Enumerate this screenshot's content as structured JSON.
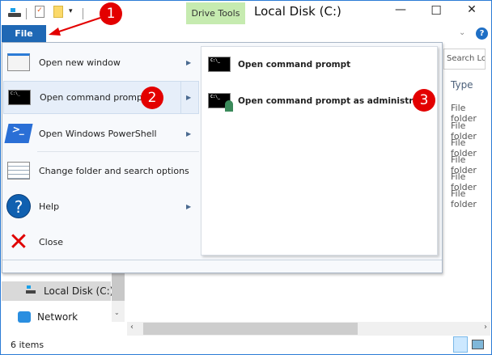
{
  "window": {
    "title": "Local Disk (C:)",
    "context_tab": "Drive Tools",
    "minimize": "—",
    "maximize": "☐",
    "close": "✕"
  },
  "ribbon": {
    "file_tab": "File",
    "help": "?"
  },
  "file_menu": {
    "items": [
      {
        "label": "Open new window",
        "has_submenu": true
      },
      {
        "label": "Open command prompt",
        "has_submenu": true,
        "highlighted": true
      },
      {
        "label": "Open Windows PowerShell",
        "has_submenu": true
      },
      {
        "label": "Change folder and search options",
        "has_submenu": false
      },
      {
        "label": "Help",
        "has_submenu": true
      },
      {
        "label": "Close",
        "has_submenu": false
      }
    ],
    "submenu": [
      "Open command prompt",
      "Open command prompt as administrator"
    ]
  },
  "annotations": [
    "1",
    "2",
    "3"
  ],
  "background": {
    "search_placeholder": "Search Lo...",
    "column_type": "Type",
    "rows": [
      "File folder",
      "File folder",
      "File folder",
      "File folder",
      "File folder",
      "File folder"
    ],
    "nav": {
      "selected": "Local Disk (C:)",
      "network": "Network"
    }
  },
  "status": {
    "items": "6 items"
  },
  "colors": {
    "accent": "#1f68b5",
    "annotation": "#e30000",
    "context_tab": "#c6ebb0"
  }
}
